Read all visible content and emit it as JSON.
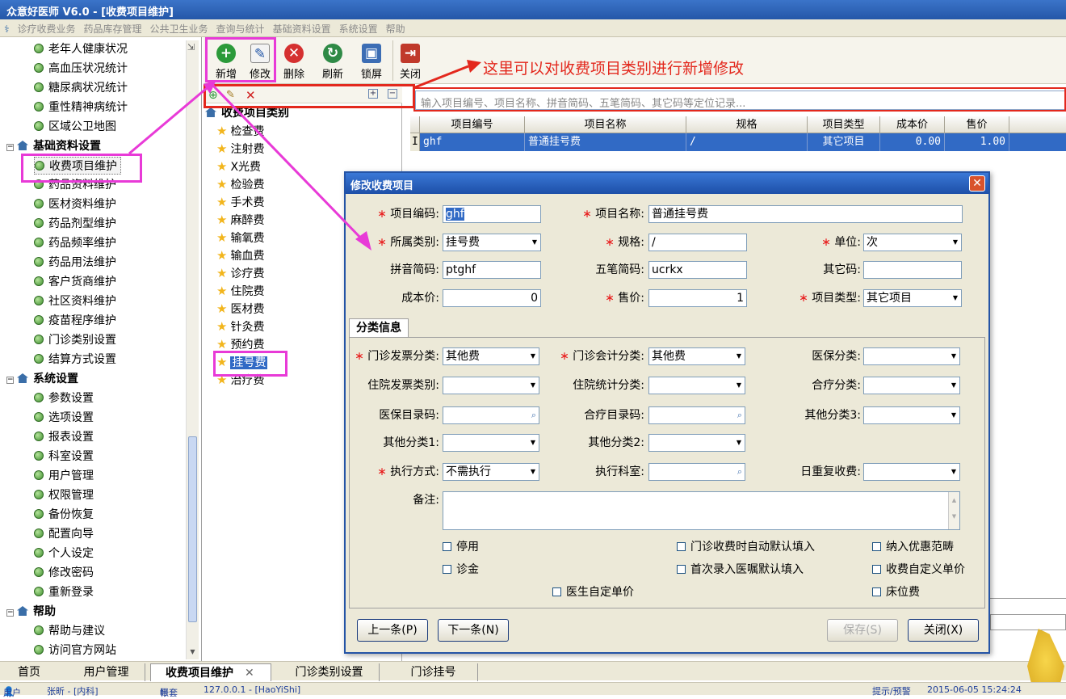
{
  "app": {
    "title": "众意好医师 V6.0 - [收费项目维护]"
  },
  "menu": [
    "诊疗收费业务",
    "药品库存管理",
    "公共卫生业务",
    "查询与统计",
    "基础资料设置",
    "系统设置",
    "帮助"
  ],
  "tree": {
    "top_items": [
      "老年人健康状况",
      "高血压状况统计",
      "糖尿病状况统计",
      "重性精神病统计",
      "区域公卫地图"
    ],
    "group1": "基础资料设置",
    "group1_items": [
      "收费项目维护",
      "药品资料维护",
      "医材资料维护",
      "药品剂型维护",
      "药品频率维护",
      "药品用法维护",
      "客户货商维护",
      "社区资料维护",
      "疫苗程序维护",
      "门诊类别设置",
      "结算方式设置"
    ],
    "group2": "系统设置",
    "group2_items": [
      "参数设置",
      "选项设置",
      "报表设置",
      "科室设置",
      "用户管理",
      "权限管理",
      "备份恢复",
      "配置向导",
      "个人设定",
      "修改密码",
      "重新登录"
    ],
    "group3": "帮助",
    "group3_items": [
      "帮助与建议",
      "访问官方网站"
    ]
  },
  "toolbar": {
    "add": "新增",
    "edit": "修改",
    "delete": "删除",
    "refresh": "刷新",
    "lock": "锁屏",
    "close": "关闭"
  },
  "annotation": "这里可以对收费项目类别进行新增修改",
  "category": {
    "root": "收费项目类别",
    "items": [
      "检查费",
      "注射费",
      "X光费",
      "检验费",
      "手术费",
      "麻醉费",
      "输氧费",
      "输血费",
      "诊疗费",
      "住院费",
      "医材费",
      "针灸费",
      "预约费",
      "挂号费",
      "治疗费"
    ]
  },
  "search": {
    "placeholder": "输入项目编号、项目名称、拼音简码、五笔简码、其它码等定位记录..."
  },
  "grid": {
    "columns": [
      "项目编号",
      "项目名称",
      "规格",
      "项目类型",
      "成本价",
      "售价"
    ],
    "row": {
      "marker": "I",
      "code": "ghf",
      "name": "普通挂号费",
      "spec": "/",
      "type": "其它项目",
      "cost": "0.00",
      "price": "1.00"
    }
  },
  "dialog": {
    "title": "修改收费项目",
    "labels": {
      "code": "项目编码:",
      "name": "项目名称:",
      "category": "所属类别:",
      "spec": "规格:",
      "unit": "单位:",
      "pinyin": "拼音简码:",
      "wubi": "五笔简码:",
      "other_code": "其它码:",
      "cost": "成本价:",
      "price": "售价:",
      "item_type": "项目类型:"
    },
    "values": {
      "code": "ghf",
      "name": "普通挂号费",
      "category": "挂号费",
      "spec": "/",
      "unit": "次",
      "pinyin": "ptghf",
      "wubi": "ucrkx",
      "other_code": "",
      "cost": "0",
      "price": "1",
      "item_type": "其它项目"
    },
    "tab": "分类信息",
    "cls_labels": {
      "op_invoice": "门诊发票分类:",
      "op_account": "门诊会计分类:",
      "insurance": "医保分类:",
      "ip_invoice": "住院发票类别:",
      "ip_stat": "住院统计分类:",
      "coop": "合疗分类:",
      "ins_code": "医保目录码:",
      "coop_code": "合疗目录码:",
      "other3": "其他分类3:",
      "other1": "其他分类1:",
      "other2": "其他分类2:",
      "exec_mode": "执行方式:",
      "exec_dept": "执行科室:",
      "daily_repeat": "日重复收费:",
      "remark": "备注:"
    },
    "cls_values": {
      "op_invoice": "其他费",
      "op_account": "其他费",
      "exec_mode": "不需执行"
    },
    "checks": {
      "disabled": "停用",
      "auto_fill": "门诊收费时自动默认填入",
      "discount": "纳入优惠范畴",
      "consult": "诊金",
      "first_entry": "首次录入医嘱默认填入",
      "custom_unit": "收费自定义单价",
      "doctor_price": "医生自定单价",
      "bed_fee": "床位费"
    },
    "buttons": {
      "prev": "上一条(P)",
      "next": "下一条(N)",
      "save": "保存(S)",
      "close": "关闭(X)"
    }
  },
  "bottom_tabs": [
    "首页",
    "用户管理",
    "收费项目维护",
    "门诊类别设置",
    "门诊挂号"
  ],
  "status": {
    "user_label": "用户",
    "user": "张昕 - [内科]",
    "account_label": "帐套",
    "server": "127.0.0.1 - [HaoYiShi]",
    "hint": "提示/预警",
    "datetime": "2015-06-05 15:24:24"
  }
}
